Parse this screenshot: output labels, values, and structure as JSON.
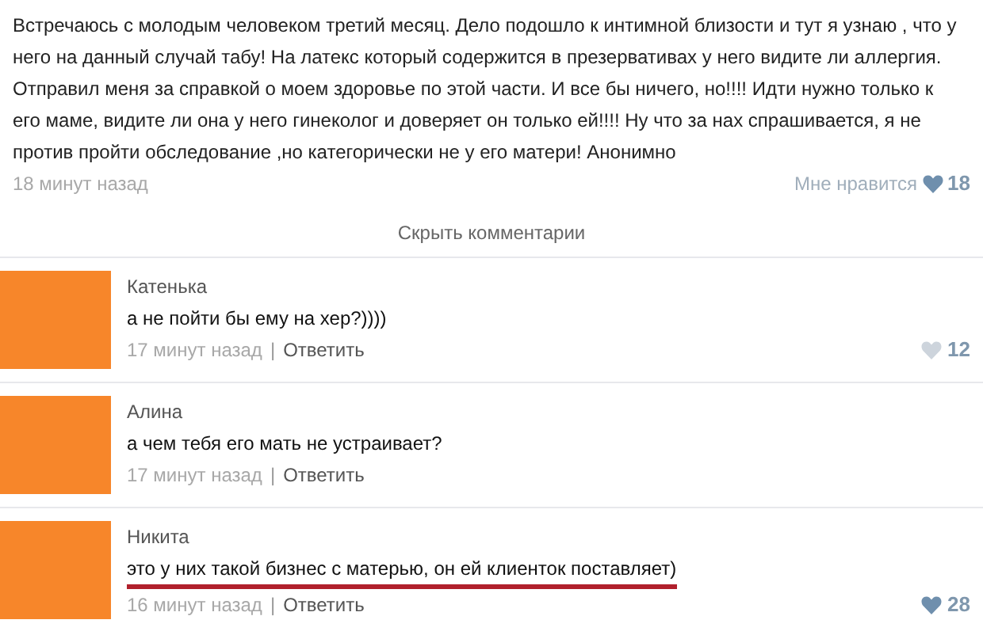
{
  "post": {
    "lines": [
      "Встречаюсь с молодым человеком третий месяц. Дело подошло к интимной близости и тут я узнаю , что у",
      "него на данный случай табу! На латекс который содержится в презервативах у него видите ли аллергия.",
      "Отправил меня за справкой о моем здоровье по этой части. И все бы ничего, но!!!! Идти нужно только к",
      "его маме, видите ли она у него гинеколог и доверяет он только ей!!!! Ну что за нах спрашивается, я не",
      "против пройти обследование ,но категорически не у его матери! Анонимно"
    ],
    "time": "18 минут назад",
    "like_label": "Мне нравится",
    "likes": "18",
    "liked": true
  },
  "hide_comments": "Скрыть комментарии",
  "separator": "|",
  "comments": [
    {
      "author": "Катенька",
      "text": "а не пойти бы ему на хер?))))",
      "time": "17 минут назад",
      "reply": "Ответить",
      "likes": "12",
      "liked": false,
      "underlined": false
    },
    {
      "author": "Алина",
      "text": "а чем тебя его мать не устраивает?",
      "time": "17 минут назад",
      "reply": "Ответить",
      "underlined": false
    },
    {
      "author": "Никита",
      "text": "это у них такой бизнес с матерью, он ей клиенток поставляет)",
      "time": "16 минут назад",
      "reply": "Ответить",
      "likes": "28",
      "liked": true,
      "underlined": true
    }
  ]
}
